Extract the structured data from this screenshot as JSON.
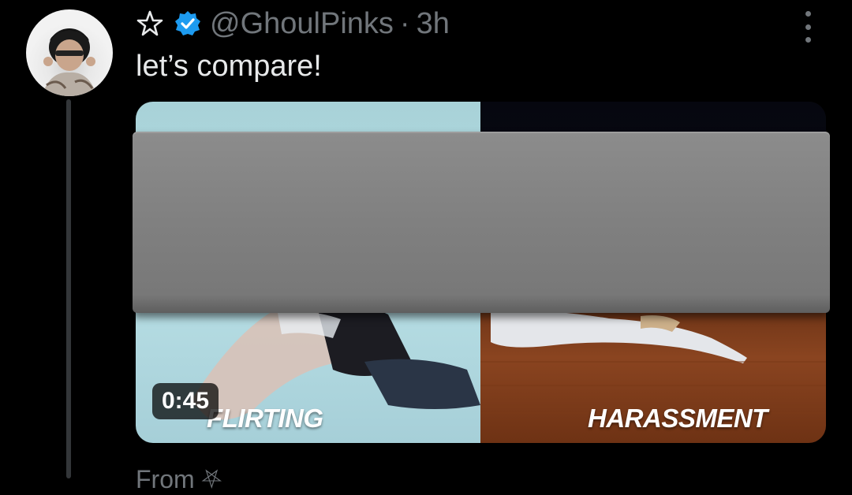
{
  "tweet": {
    "handle": "@GhoulPinks",
    "separator": "·",
    "time": "3h",
    "text": "let’s compare!",
    "name_icon": "pentagram-icon",
    "verified_icon": "verified-badge-icon",
    "verified_color": "#1d9bf0"
  },
  "media": {
    "duration": "0:45",
    "left_caption": "FLIRTING",
    "right_caption": "HARASSMENT",
    "redaction_color": "#808080"
  },
  "footer": {
    "from_label": "From ⛧"
  },
  "colors": {
    "background": "#000000",
    "primary_text": "#e7e9ea",
    "secondary_text": "#71767b",
    "thread_line": "#333639"
  }
}
